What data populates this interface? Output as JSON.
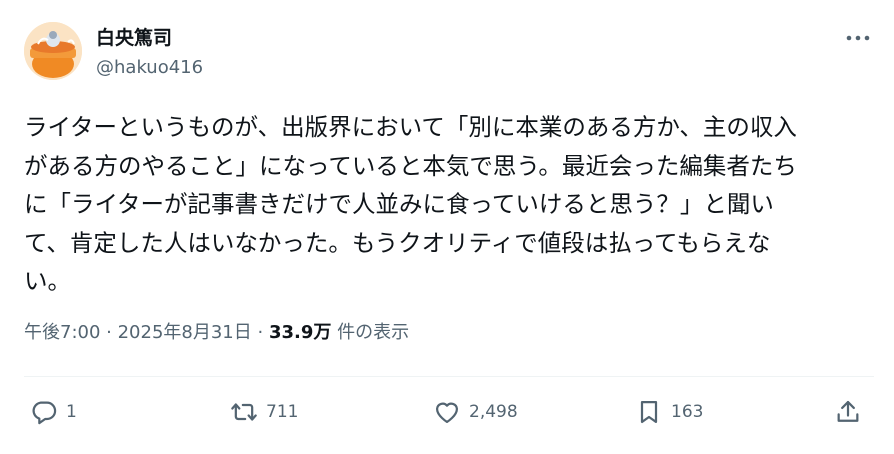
{
  "author": {
    "display_name": "白央篤司",
    "handle": "@hakuo416",
    "avatar_icon": "pot-avatar-icon"
  },
  "more_icon": "more-dots-icon",
  "tweet": {
    "lines": [
      "ライターというものが、出版界において「別に本業のある方か、主の収入",
      "がある方のやること」になっていると本気で思う。最近会った編集者たち",
      "に「ライターが記事書きだけで人並みに食っていけると思う？」と聞い",
      "て、肯定した人はいなかった。もうクオリティで値段は払ってもらえな",
      "い。"
    ]
  },
  "meta": {
    "time": "午後7:00",
    "sep1": " · ",
    "date": "2025年8月31日",
    "sep2": " · ",
    "views": "33.9万",
    "views_label": " 件の表示"
  },
  "actions": {
    "reply": {
      "icon": "reply-icon",
      "count": "1"
    },
    "retweet": {
      "icon": "retweet-icon",
      "count": "711"
    },
    "like": {
      "icon": "heart-icon",
      "count": "2,498"
    },
    "bookmark": {
      "icon": "bookmark-icon",
      "count": "163"
    },
    "share": {
      "icon": "share-icon"
    }
  },
  "colors": {
    "text": "#0f1419",
    "secondary": "#536471",
    "divider": "#eff3f4"
  }
}
